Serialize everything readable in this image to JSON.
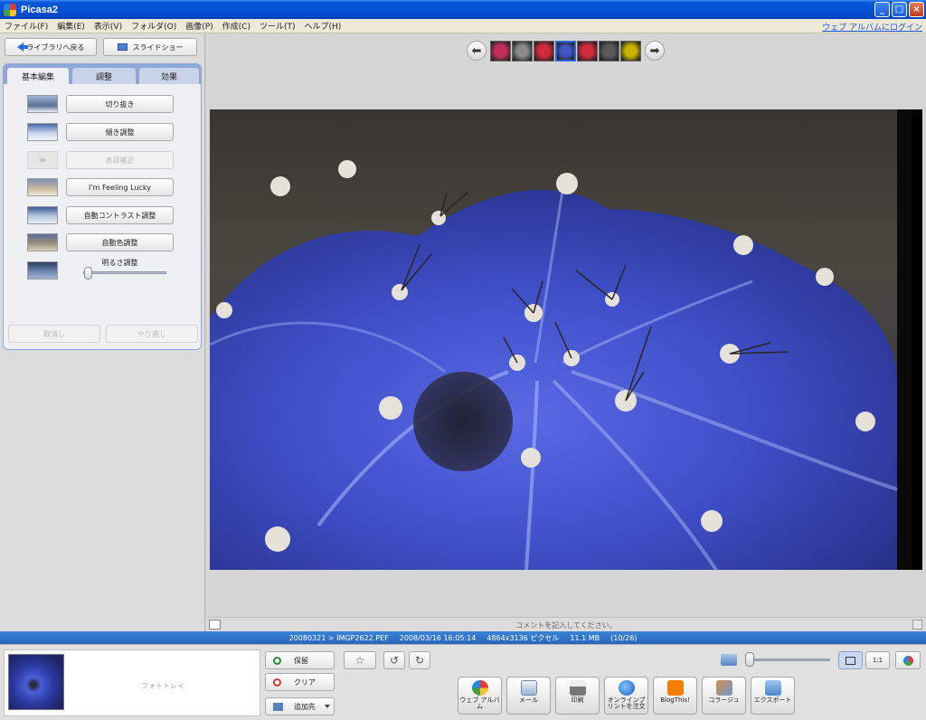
{
  "window": {
    "title": "Picasa2",
    "controls": {
      "minimize": "_",
      "maximize": "□",
      "close": "×"
    }
  },
  "menu": {
    "items": [
      "ファイル(F)",
      "編集(E)",
      "表示(V)",
      "フォルダ(O)",
      "画像(P)",
      "作成(C)",
      "ツール(T)",
      "ヘルプ(H)"
    ],
    "login_link": "ウェブ アルバムにログイン"
  },
  "left": {
    "back_label": "ライブラリへ戻る",
    "slideshow_label": "スライドショー",
    "tabs": [
      "基本編集",
      "調整",
      "効果"
    ],
    "tools": [
      "切り抜き",
      "傾き調整",
      "赤目補正",
      "I'm Feeling Lucky",
      "自動コントラスト調整",
      "自動色調整"
    ],
    "brightness_label": "明るさ調整",
    "brightness_level": 0.05,
    "undo_label": "取消し",
    "redo_label": "やり直し"
  },
  "filmstrip": {
    "prev_glyph": "⬅",
    "next_glyph": "➡",
    "thumb_colors": [
      "#c2305a",
      "#8a8a8a",
      "#d22a3a",
      "#4257c6",
      "#d22a3a",
      "#5a5a5a",
      "#c9b400"
    ],
    "current_index": 3
  },
  "photo": {
    "dominant_color": "#3f4fc8"
  },
  "comment": {
    "placeholder": "コメントを記入してください。"
  },
  "status": {
    "path": "20080321 > IMGP2622.PEF",
    "datetime": "2008/03/16 16:05:14",
    "dimensions": "4864x3136 ピクセル",
    "size": "11.1 MB",
    "position": "(10/26)"
  },
  "tray": {
    "label": "フォトトレイ",
    "hold_label": "保留",
    "clear_label": "クリア",
    "addto_label": "追加先"
  },
  "toolbar": {
    "star_glyph": "☆",
    "rotate_left_glyph": "↺",
    "rotate_right_glyph": "↻",
    "actual_size_label": "1:1",
    "zoom_level": 0.03
  },
  "actions": [
    {
      "label": "ウェブ アルバム",
      "icon": "web-album-icon"
    },
    {
      "label": "メール",
      "icon": "mail-icon"
    },
    {
      "label": "印刷",
      "icon": "printer-icon"
    },
    {
      "label": "オンラインプリントを注文",
      "icon": "globe-icon"
    },
    {
      "label": "BlogThis!",
      "icon": "blogger-icon"
    },
    {
      "label": "コラージュ",
      "icon": "collage-icon"
    },
    {
      "label": "エクスポート",
      "icon": "export-icon"
    }
  ]
}
